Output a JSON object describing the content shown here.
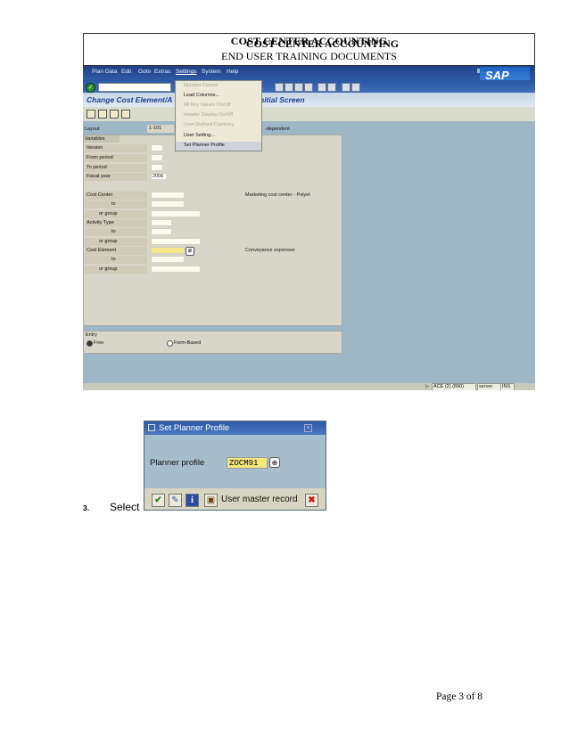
{
  "header": {
    "title_line1": "COST CENTER ACCOUNTING",
    "title_line1_overlap": "COST CENTER ACCOUNTING",
    "title_line2": "END USER TRAINING DOCUMENTS"
  },
  "sap_window": {
    "menu_bar": [
      "Plan Data",
      "Edit",
      "Goto",
      "Extras",
      "Settings",
      "System",
      "Help"
    ],
    "logo": "SAP",
    "screen_title_left": "Change Cost Element/A",
    "screen_title_right": "nitial Screen",
    "settings_menu": {
      "items": [
        {
          "label": "Number Format",
          "enabled": false
        },
        {
          "label": "Lead Columns...",
          "enabled": true
        },
        {
          "label": "All Key Values On/Off",
          "enabled": false
        },
        {
          "label": "Header Display On/Off",
          "enabled": false
        },
        {
          "label": "User-Defined Currency",
          "enabled": false
        },
        {
          "label": "User Setting...",
          "enabled": true
        },
        {
          "label": "Set Planner Profile",
          "enabled": true
        }
      ]
    },
    "layout_label": "Layout",
    "layout_value": "1-101",
    "layout_suffix": "-dependent",
    "variables_tab": "Variables",
    "variables": [
      {
        "label": "Version",
        "value": ""
      },
      {
        "label": "From period",
        "value": ""
      },
      {
        "label": "To period",
        "value": ""
      },
      {
        "label": "Fiscal year",
        "value": "2006"
      }
    ],
    "cost_center": {
      "label": "Cost Center",
      "to": "to",
      "or_group": "or group",
      "description": "Marketing cost center - Polyet"
    },
    "activity_type": {
      "label": "Activity Type",
      "to": "to",
      "or_group": "or group"
    },
    "cost_element": {
      "label": "Cost Element",
      "to": "to",
      "or_group": "or group",
      "description": "Conveyance expenses"
    },
    "entry_tab": "Entry",
    "entry_options": [
      "Free",
      "Form-Based"
    ],
    "entry_selected": "Free",
    "status_bar": {
      "system": "ACE (2) (890)",
      "server": "server",
      "mode": "INS"
    }
  },
  "dialog": {
    "title": "Set Planner Profile",
    "field_label": "Planner profile",
    "field_value": "ZOCM91",
    "button_user_master": "User master record"
  },
  "body": {
    "step_number": "3.",
    "step_text": "Select"
  },
  "footer": {
    "page": "Page 3 of 8"
  },
  "colors": {
    "sap_blue": "#2f5aa6",
    "screen_bg": "#9db7c7",
    "panel_bg": "#d8d6c9",
    "input_highlight": "#f5e87f"
  }
}
